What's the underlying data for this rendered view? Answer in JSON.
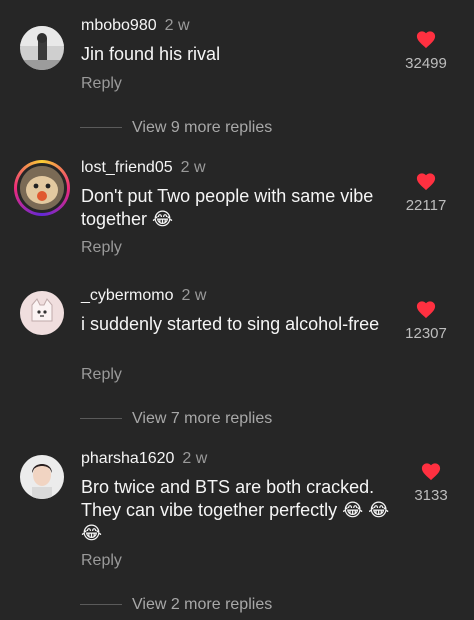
{
  "colors": {
    "background": "#262626",
    "heart": "#ff3040",
    "muted": "#9a9a9a"
  },
  "comments": [
    {
      "username": "mbobo980",
      "time": "2 w",
      "text": "Jin found his rival",
      "reply": "Reply",
      "likes": "32499"
    },
    {
      "username": "lost_friend05",
      "time": "2 w",
      "text": "Don't put Two people with same vibe together 😂",
      "reply": "Reply",
      "likes": "22117"
    },
    {
      "username": "_cybermomo",
      "time": "2 w",
      "text": "i suddenly started to sing alcohol-free",
      "reply": "Reply",
      "likes": "12307"
    },
    {
      "username": "pharsha1620",
      "time": "2 w",
      "text": "Bro twice and BTS are both cracked. They can vibe together perfectly 😂 😂😂",
      "reply": "Reply",
      "likes": "3133"
    }
  ],
  "view_more": [
    "View 9 more replies",
    "View 7 more replies",
    "View 2 more replies"
  ]
}
